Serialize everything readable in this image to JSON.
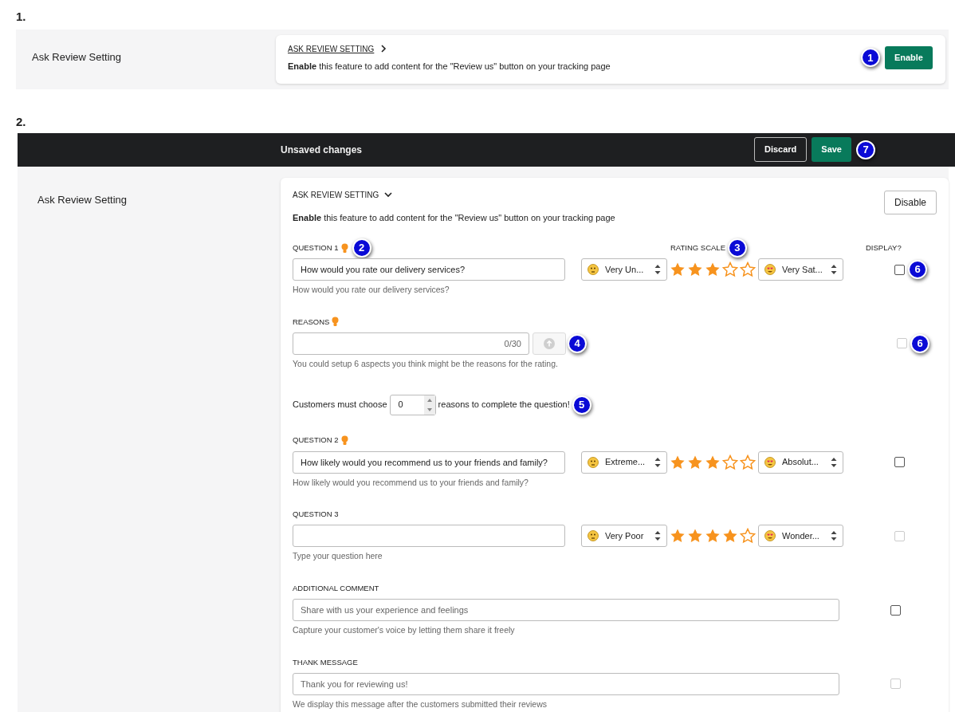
{
  "section_1": {
    "heading": "1.",
    "label": "Ask Review Setting",
    "card": {
      "title": "ASK REVIEW SETTING",
      "expanded": false,
      "description": "**Enable** this feature to add content for the \"Review us\" button on your tracking page",
      "button": {
        "label": "Enable",
        "kind": "enable"
      },
      "callout": "1"
    }
  },
  "section_2": {
    "heading": "2.",
    "save_bar": {
      "title": "Unsaved changes",
      "discard": "Discard",
      "save": "Save",
      "callout": "7"
    },
    "label": "Ask Review Setting",
    "card": {
      "title": "ASK REVIEW SETTING",
      "expanded": true,
      "description": "**Enable** this feature to add content for the \"Review us\" button on your tracking page",
      "button": {
        "label": "Disable",
        "kind": "disable"
      },
      "rating_scale_label": "RATING SCALE",
      "rating_callout": "3",
      "display_label": "DISPLAY?",
      "fields": [
        {
          "kind": "question",
          "label": "QUESTION 1",
          "tip": true,
          "callout": "2",
          "value": "How would you rate our delivery services?",
          "hint": "How would you rate our delivery services?",
          "low": "Very Un...",
          "stars": 3,
          "high": "Very Sat...",
          "display": {
            "checked": false,
            "disabled": false,
            "callout": "6"
          }
        },
        {
          "kind": "reasons",
          "label": "REASONS",
          "tip": true,
          "counter": "0/30",
          "upload_disabled": true,
          "callout": "4",
          "hint": "You could setup 6 aspects you think might be the reasons for the rating.",
          "display": {
            "checked": false,
            "disabled": true,
            "callout": "6"
          },
          "min_choice": {
            "before": "Customers must choose",
            "value": "0",
            "after": "reasons to complete the question!",
            "callout": "5"
          }
        },
        {
          "kind": "question",
          "label": "QUESTION 2",
          "tip": true,
          "value": "How likely would you recommend us to your friends and family?",
          "hint": "How likely would you recommend us to your friends and family?",
          "low": "Extreme...",
          "stars": 3,
          "high": "Absolut...",
          "display": {
            "checked": false,
            "disabled": false
          }
        },
        {
          "kind": "question",
          "label": "QUESTION 3",
          "tip": false,
          "hint": "Type your question here",
          "low": "Very Poor",
          "stars": 4,
          "high": "Wonder...",
          "display": {
            "checked": false,
            "disabled": true
          }
        },
        {
          "kind": "text",
          "label": "ADDITIONAL COMMENT",
          "placeholder": "Share with us your experience and feelings",
          "hint": "Capture your customer's voice by letting them share it freely",
          "display": {
            "checked": false,
            "disabled": false
          }
        },
        {
          "kind": "text",
          "label": "THANK MESSAGE",
          "placeholder": "Thank you for reviewing us!",
          "hint": "We display this message after the customers submitted their reviews",
          "display": {
            "checked": false,
            "disabled": true
          }
        }
      ]
    }
  }
}
